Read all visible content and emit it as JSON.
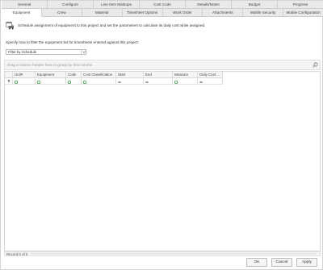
{
  "tabs_row1": [
    {
      "label": "General"
    },
    {
      "label": "Configure"
    },
    {
      "label": "Line Item Markups"
    },
    {
      "label": "Cost Code"
    },
    {
      "label": "Details/Notes"
    },
    {
      "label": "Budget"
    },
    {
      "label": "Progress"
    }
  ],
  "tabs_row2": [
    {
      "label": "Equipment",
      "active": true
    },
    {
      "label": "Crew"
    },
    {
      "label": "Material"
    },
    {
      "label": "Timesheet Options"
    },
    {
      "label": "Work Order"
    },
    {
      "label": "Attachments"
    },
    {
      "label": "Mobile Security"
    },
    {
      "label": "Mobile Configuration"
    }
  ],
  "description": {
    "icon": "equipment-calendar-icon",
    "text": "Schedule assignment of equipment to this project and set the parameters to calculate its daily cost while assigned."
  },
  "filter": {
    "label": "Specify how to filter the equipment list for timesheets entered against this project:",
    "value": "Filter by Schedule"
  },
  "group_panel": {
    "hint": "Drag a column header here to group by that column",
    "icon": "search-icon"
  },
  "grid": {
    "columns": [
      "Unit#",
      "Equipment",
      "Code",
      "Cost Classification",
      "Start",
      "End",
      "Measure",
      "Daily Cost ..."
    ],
    "filter_icons": [
      "filter-icon",
      "filter-icon",
      "filter-icon",
      "filter-icon",
      "equals-icon",
      "equals-icon",
      "filter-icon",
      "equals-icon"
    ]
  },
  "footer": {
    "record_text": "Record 0 of 0"
  },
  "buttons": {
    "ok": "OK",
    "cancel": "Cancel",
    "apply": "Apply"
  },
  "colors": {
    "tab_bg": "#e9e9e9",
    "active_tab_bg": "#ffffff",
    "accent_green": "#3a9a4a"
  }
}
